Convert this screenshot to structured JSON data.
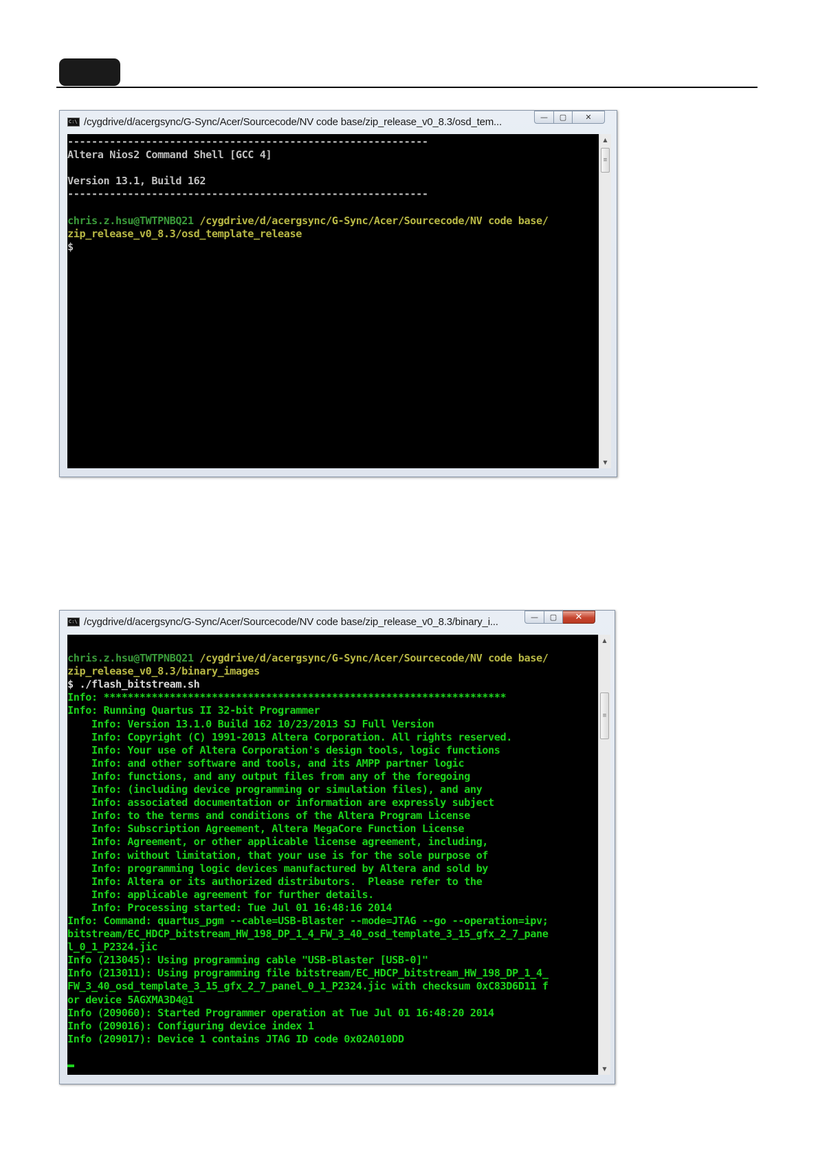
{
  "window1": {
    "title": "/cygdrive/d/acergsync/G-Sync/Acer/Sourcecode/NV code base/zip_release_v0_8.3/osd_tem...",
    "icon_text": "C:\\",
    "lines": [
      "------------------------------------------------------------",
      "Altera Nios2 Command Shell [GCC 4]",
      "",
      "Version 13.1, Build 162",
      "------------------------------------------------------------",
      "",
      ""
    ],
    "prompt_user": "chris.z.hsu@TWTPNBQ21",
    "prompt_path_1": " /cygdrive/d/acergsync/G-Sync/Acer/Sourcecode/NV code base/",
    "prompt_path_2": "zip_release_v0_8.3/osd_template_release",
    "prompt_symbol": "$"
  },
  "window2": {
    "title": "/cygdrive/d/acergsync/G-Sync/Acer/Sourcecode/NV code base/zip_release_v0_8.3/binary_i...",
    "icon_text": "C:\\",
    "prompt_user": "chris.z.hsu@TWTPNBQ21",
    "prompt_path_1": " /cygdrive/d/acergsync/G-Sync/Acer/Sourcecode/NV code base/",
    "prompt_path_2": "zip_release_v0_8.3/binary_images",
    "command": "$ ./flash_bitstream.sh",
    "output": [
      "Info: *******************************************************************",
      "Info: Running Quartus II 32-bit Programmer",
      "    Info: Version 13.1.0 Build 162 10/23/2013 SJ Full Version",
      "    Info: Copyright (C) 1991-2013 Altera Corporation. All rights reserved.",
      "    Info: Your use of Altera Corporation's design tools, logic functions",
      "    Info: and other software and tools, and its AMPP partner logic",
      "    Info: functions, and any output files from any of the foregoing",
      "    Info: (including device programming or simulation files), and any",
      "    Info: associated documentation or information are expressly subject",
      "    Info: to the terms and conditions of the Altera Program License",
      "    Info: Subscription Agreement, Altera MegaCore Function License",
      "    Info: Agreement, or other applicable license agreement, including,",
      "    Info: without limitation, that your use is for the sole purpose of",
      "    Info: programming logic devices manufactured by Altera and sold by",
      "    Info: Altera or its authorized distributors.  Please refer to the",
      "    Info: applicable agreement for further details.",
      "    Info: Processing started: Tue Jul 01 16:48:16 2014",
      "Info: Command: quartus_pgm --cable=USB-Blaster --mode=JTAG --go --operation=ipv;",
      "bitstream/EC_HDCP_bitstream_HW_198_DP_1_4_FW_3_40_osd_template_3_15_gfx_2_7_pane",
      "l_0_1_P2324.jic",
      "Info (213045): Using programming cable \"USB-Blaster [USB-0]\"",
      "Info (213011): Using programming file bitstream/EC_HDCP_bitstream_HW_198_DP_1_4_",
      "FW_3_40_osd_template_3_15_gfx_2_7_panel_0_1_P2324.jic with checksum 0xC83D6D11 f",
      "or device 5AGXMA3D4@1",
      "Info (209060): Started Programmer operation at Tue Jul 01 16:48:20 2014",
      "Info (209016): Configuring device index 1",
      "Info (209017): Device 1 contains JTAG ID code 0x02A010DD"
    ]
  }
}
